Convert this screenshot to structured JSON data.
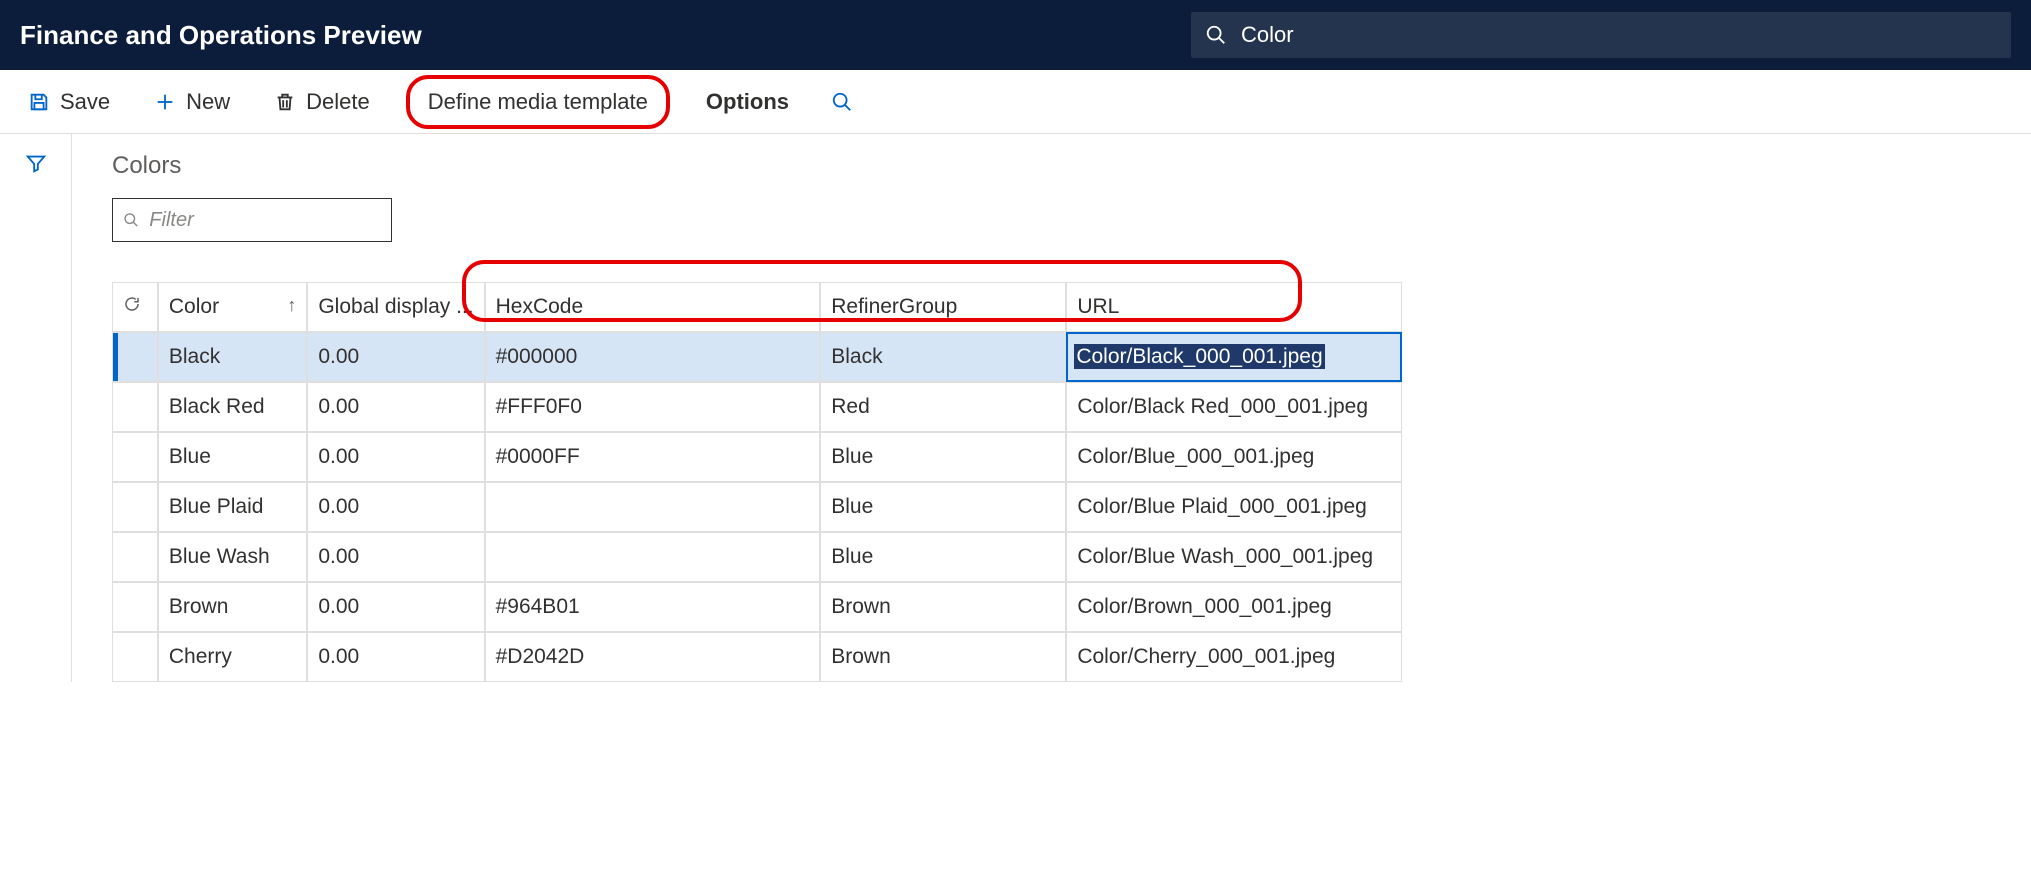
{
  "header": {
    "title": "Finance and Operations Preview",
    "search_value": "Color"
  },
  "toolbar": {
    "save": "Save",
    "new": "New",
    "delete": "Delete",
    "define_media": "Define media template",
    "options": "Options"
  },
  "page": {
    "heading": "Colors",
    "filter_placeholder": "Filter"
  },
  "columns": {
    "color": "Color",
    "global_display": "Global display ...",
    "hex": "HexCode",
    "refiner": "RefinerGroup",
    "url": "URL"
  },
  "rows": [
    {
      "color": "Black",
      "gdo": "0.00",
      "hex": "#000000",
      "refiner": "Black",
      "url": "Color/Black_000_001.jpeg",
      "selected": true
    },
    {
      "color": "Black Red",
      "gdo": "0.00",
      "hex": "#FFF0F0",
      "refiner": "Red",
      "url": "Color/Black Red_000_001.jpeg"
    },
    {
      "color": "Blue",
      "gdo": "0.00",
      "hex": "#0000FF",
      "refiner": "Blue",
      "url": "Color/Blue_000_001.jpeg"
    },
    {
      "color": "Blue Plaid",
      "gdo": "0.00",
      "hex": "",
      "refiner": "Blue",
      "url": "Color/Blue Plaid_000_001.jpeg"
    },
    {
      "color": "Blue Wash",
      "gdo": "0.00",
      "hex": "",
      "refiner": "Blue",
      "url": "Color/Blue Wash_000_001.jpeg"
    },
    {
      "color": "Brown",
      "gdo": "0.00",
      "hex": "#964B01",
      "refiner": "Brown",
      "url": "Color/Brown_000_001.jpeg"
    },
    {
      "color": "Cherry",
      "gdo": "0.00",
      "hex": "#D2042D",
      "refiner": "Brown",
      "url": "Color/Cherry_000_001.jpeg"
    }
  ]
}
